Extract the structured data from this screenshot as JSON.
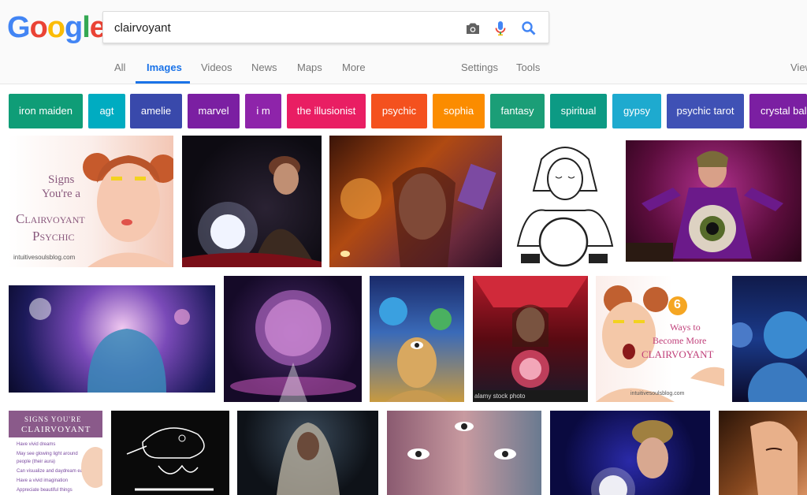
{
  "search": {
    "query": "clairvoyant"
  },
  "nav": {
    "tabs": [
      {
        "label": "All",
        "active": false
      },
      {
        "label": "Images",
        "active": true
      },
      {
        "label": "Videos",
        "active": false
      },
      {
        "label": "News",
        "active": false
      },
      {
        "label": "Maps",
        "active": false
      },
      {
        "label": "More",
        "active": false
      }
    ],
    "settings": "Settings",
    "tools": "Tools",
    "view": "View"
  },
  "chips": [
    {
      "label": "iron maiden",
      "color": "#0f9d77"
    },
    {
      "label": "agt",
      "color": "#00acc1"
    },
    {
      "label": "amelie",
      "color": "#3949ab"
    },
    {
      "label": "marvel",
      "color": "#7b1fa2"
    },
    {
      "label": "i m",
      "color": "#8e24aa"
    },
    {
      "label": "the illusionist",
      "color": "#e91e63"
    },
    {
      "label": "psychic",
      "color": "#f4511e"
    },
    {
      "label": "sophia",
      "color": "#fb8c00"
    },
    {
      "label": "fantasy",
      "color": "#1b9e77"
    },
    {
      "label": "spiritual",
      "color": "#0c9a84"
    },
    {
      "label": "gypsy",
      "color": "#1eaacf"
    },
    {
      "label": "psychic tarot",
      "color": "#3f51b5"
    },
    {
      "label": "crystal ball",
      "color": "#7b1fa2"
    }
  ],
  "images": {
    "img1": {
      "line1": "Signs",
      "line2": "You're a",
      "line3": "Clairvoyant",
      "line4": "Psychic",
      "source": "intuitivesoulsblog.com"
    },
    "img14": {
      "number": "6",
      "line1": "Ways to",
      "line2": "Become More",
      "line3": "CLAIRVOYANT",
      "source": "intuitivesoulsblog.com"
    },
    "img13": {
      "watermark": "alamy stock photo"
    },
    "img16": {
      "line1": "SIGNS YOU'RE",
      "line2": "CLAIRVOYANT",
      "list": [
        "Have vivid dreams",
        "May see glowing light around",
        "people (their aura)",
        "Can visualize and daydream easily",
        "Have a vivid imagination",
        "Appreciate beautiful things"
      ]
    }
  },
  "colors": {
    "accent": "#1a73e8"
  }
}
